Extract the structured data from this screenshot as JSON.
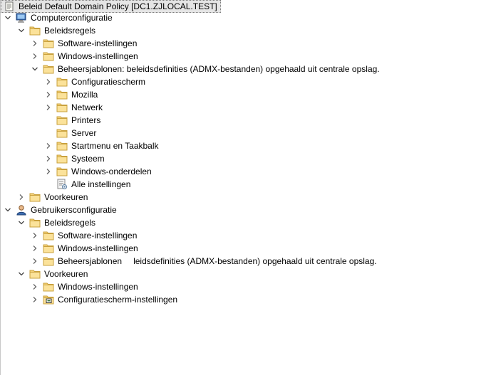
{
  "tree": {
    "root": {
      "label": "Beleid Default Domain Policy [DC1.ZJLOCAL.TEST]"
    },
    "computer": {
      "label": "Computerconfiguratie",
      "beleidsregels": {
        "label": "Beleidsregels",
        "software": "Software-instellingen",
        "windows": "Windows-instellingen",
        "beheer": {
          "label": "Beheersjablonen: beleidsdefinities (ADMX-bestanden) opgehaald uit centrale opslag.",
          "children": [
            "Configuratiescherm",
            "Mozilla",
            "Netwerk",
            "Printers",
            "Server",
            "Startmenu en Taakbalk",
            "Systeem",
            "Windows-onderdelen",
            "Alle instellingen"
          ]
        }
      },
      "voorkeuren": "Voorkeuren"
    },
    "user": {
      "label": "Gebruikersconfiguratie",
      "beleidsregels": {
        "label": "Beleidsregels",
        "software": "Software-instellingen",
        "windows": "Windows-instellingen",
        "beheer": {
          "label_start": "Beheersjablonen",
          "label_end": "leidsdefinities (ADMX-bestanden) opgehaald uit centrale opslag."
        }
      },
      "voorkeuren": {
        "label": "Voorkeuren",
        "windows": "Windows-instellingen",
        "configuratiescherm": "Configuratiescherm-instellingen"
      }
    }
  }
}
